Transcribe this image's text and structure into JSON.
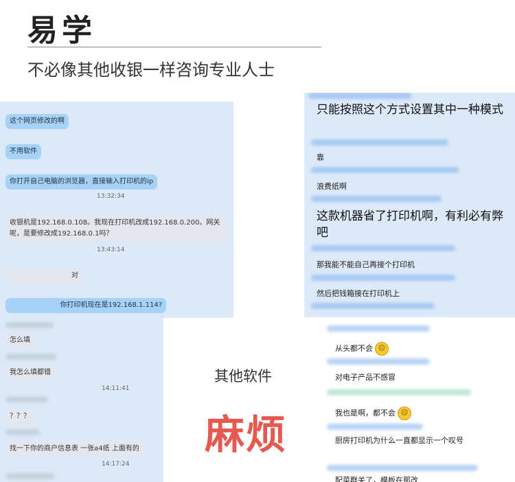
{
  "header": {
    "title": "易学",
    "subtitle": "不必像其他收银一样咨询专业人士"
  },
  "left_chat": {
    "messages": [
      {
        "text": "这个网页修改的啊"
      },
      {
        "text": "不用软件"
      },
      {
        "text": "你打开自己电脑的浏览器，直接输入打印机的ip"
      },
      {
        "time": "13:32:34"
      },
      {
        "text": "收银机是192.168.0.108。我现在打印机改成192.168.0.200。网关呢，是要修改成192.168.0.1吗？"
      },
      {
        "time": "13:43:14"
      },
      {
        "text": "对"
      },
      {
        "text": "你打印机现在是192.168.1.114?"
      },
      {
        "text": "怎么填"
      },
      {
        "text": "我怎么填都错"
      },
      {
        "time": "14:11:41"
      },
      {
        "text": "？？？"
      },
      {
        "text": "找一下你的商户信息表   一张a4纸  上面有的"
      },
      {
        "time": "14:17:24"
      }
    ]
  },
  "right_chat": {
    "messages": [
      {
        "text": "只能按照这个方式设置其中一种模式"
      },
      {
        "text": "靠"
      },
      {
        "text": "浪费纸啊"
      },
      {
        "text": "这款机器省了打印机啊，有利必有弊吧"
      },
      {
        "text": "那我能不能自己再接个打印机"
      },
      {
        "text": "然后把钱箱接在打印机上"
      },
      {
        "text": "从头都不会"
      },
      {
        "text": "对电子产品不感冒"
      },
      {
        "text": "我也是啊，都不会"
      },
      {
        "text": "厨房打印机为什么一直都显示一个叹号"
      },
      {
        "text": "配菜群关了，模板在那改"
      }
    ]
  },
  "center": {
    "label": "其他软件",
    "emphasis": "麻烦"
  },
  "icons": {
    "emoji": "frowning-face-icon"
  },
  "colors": {
    "emphasis": "#e55a50",
    "chat_bg": "#dbe9f8",
    "bubble_blue": "#a7d2f7"
  }
}
